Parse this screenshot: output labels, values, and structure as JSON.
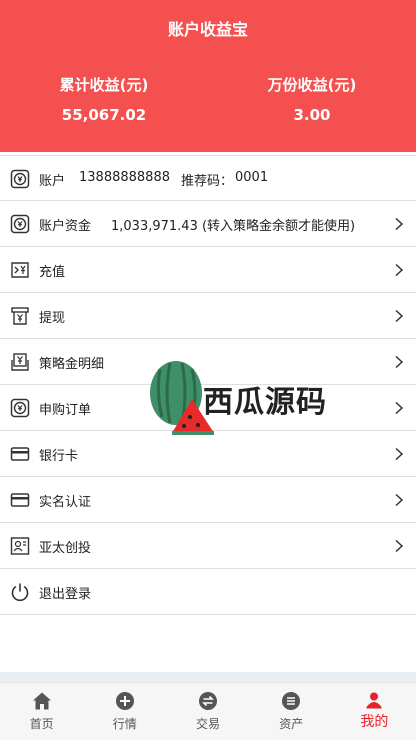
{
  "header": {
    "title": "账户收益宝",
    "stats": [
      {
        "label": "累计收益(元)",
        "value": "55,067.02"
      },
      {
        "label": "万份收益(元)",
        "value": "3.00"
      }
    ]
  },
  "account": {
    "label": "账户",
    "number": "13888888888",
    "referral_label": "推荐码：",
    "referral_code": "0001"
  },
  "funds": {
    "label": "账户资金",
    "value": "1,033,971.43 (转入策略金余额才能使用)"
  },
  "menu": [
    {
      "label": "充值",
      "icon": "recharge-icon"
    },
    {
      "label": "提现",
      "icon": "withdraw-icon"
    },
    {
      "label": "策略金明细",
      "icon": "strategy-detail-icon"
    },
    {
      "label": "申购订单",
      "icon": "order-icon"
    },
    {
      "label": "银行卡",
      "icon": "bank-card-icon"
    },
    {
      "label": "实名认证",
      "icon": "id-card-icon"
    },
    {
      "label": "亚太创投",
      "icon": "profile-card-icon"
    }
  ],
  "logout": {
    "label": "退出登录",
    "icon": "power-icon"
  },
  "watermark": {
    "text": "西瓜源码"
  },
  "tabs": [
    {
      "label": "首页",
      "icon": "home-icon",
      "active": false
    },
    {
      "label": "行情",
      "icon": "plus-circle-icon",
      "active": false
    },
    {
      "label": "交易",
      "icon": "exchange-icon",
      "active": false
    },
    {
      "label": "资产",
      "icon": "assets-icon",
      "active": false
    },
    {
      "label": "我的",
      "icon": "user-icon",
      "active": true
    }
  ],
  "colors": {
    "header": "#f45050",
    "active_tab": "#e8222b"
  }
}
